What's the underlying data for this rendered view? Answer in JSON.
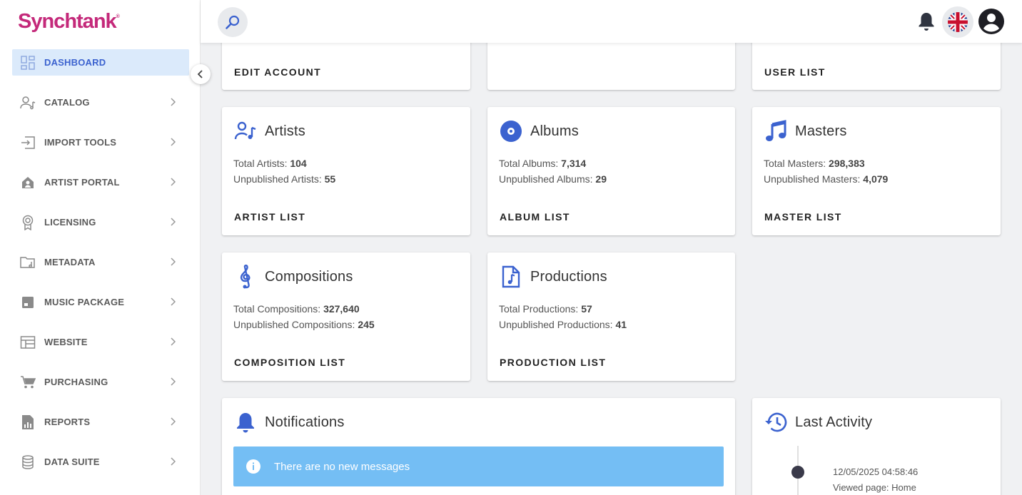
{
  "brand": {
    "name": "Synchtank",
    "mark": "®"
  },
  "sidebar": {
    "items": [
      {
        "label": "DASHBOARD",
        "icon": "dashboard-icon",
        "active": true
      },
      {
        "label": "CATALOG",
        "icon": "catalog-icon"
      },
      {
        "label": "IMPORT TOOLS",
        "icon": "import-icon"
      },
      {
        "label": "ARTIST PORTAL",
        "icon": "artist-portal-icon"
      },
      {
        "label": "LICENSING",
        "icon": "licensing-icon"
      },
      {
        "label": "METADATA",
        "icon": "metadata-icon"
      },
      {
        "label": "MUSIC PACKAGE",
        "icon": "music-package-icon"
      },
      {
        "label": "WEBSITE",
        "icon": "website-icon"
      },
      {
        "label": "PURCHASING",
        "icon": "cart-icon"
      },
      {
        "label": "REPORTS",
        "icon": "reports-icon"
      },
      {
        "label": "DATA SUITE",
        "icon": "database-icon"
      }
    ]
  },
  "colors": {
    "accent": "#3b62cf",
    "brand": "#c4297a",
    "info": "#74bef4",
    "active_bg": "#dbeafb"
  },
  "top_row": {
    "left_link": "EDIT ACCOUNT",
    "middle_link": "",
    "right_link": "USER LIST"
  },
  "cards": {
    "artists": {
      "title": "Artists",
      "line1_label": "Total Artists:",
      "line1_value": "104",
      "line2_label": "Unpublished Artists:",
      "line2_value": "55",
      "link": "ARTIST LIST"
    },
    "albums": {
      "title": "Albums",
      "line1_label": "Total Albums:",
      "line1_value": "7,314",
      "line2_label": "Unpublished Albums:",
      "line2_value": "29",
      "link": "ALBUM LIST"
    },
    "masters": {
      "title": "Masters",
      "line1_label": "Total Masters:",
      "line1_value": "298,383",
      "line2_label": "Unpublished Masters:",
      "line2_value": "4,079",
      "link": "MASTER LIST"
    },
    "compositions": {
      "title": "Compositions",
      "line1_label": "Total Compositions:",
      "line1_value": "327,640",
      "line2_label": "Unpublished Compositions:",
      "line2_value": "245",
      "link": "COMPOSITION LIST"
    },
    "productions": {
      "title": "Productions",
      "line1_label": "Total Productions:",
      "line1_value": "57",
      "line2_label": "Unpublished Productions:",
      "line2_value": "41",
      "link": "PRODUCTION LIST"
    }
  },
  "notifications": {
    "title": "Notifications",
    "message": "There are no new messages"
  },
  "activity": {
    "title": "Last Activity",
    "entries": [
      {
        "timestamp": "12/05/2025 04:58:46",
        "text": "Viewed page: Home"
      }
    ]
  }
}
